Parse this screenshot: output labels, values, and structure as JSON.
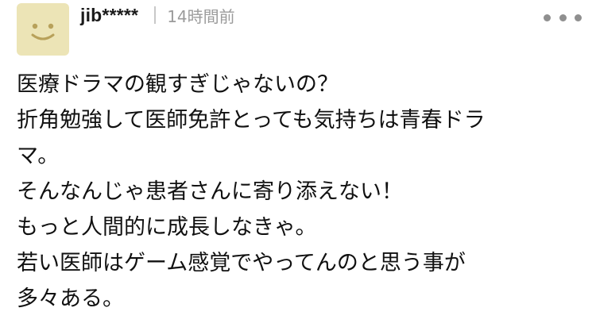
{
  "comment": {
    "avatar_icon": "smiley-face-icon",
    "avatar_color": "#ece4b6",
    "face_color": "#b8a15a",
    "username": "jib*****",
    "timestamp": "14時間前",
    "more_icon": "more-horizontal-icon",
    "lines": [
      "医療ドラマの観すぎじゃないの？",
      "折角勉強して医師免許とっても気持ちは青春ドラ",
      "マ。",
      "そんなんじゃ患者さんに寄り添えない！",
      "もっと人間的に成長しなきゃ。",
      "若い医師はゲーム感覚でやってんのと思う事が",
      "多々ある。"
    ]
  }
}
